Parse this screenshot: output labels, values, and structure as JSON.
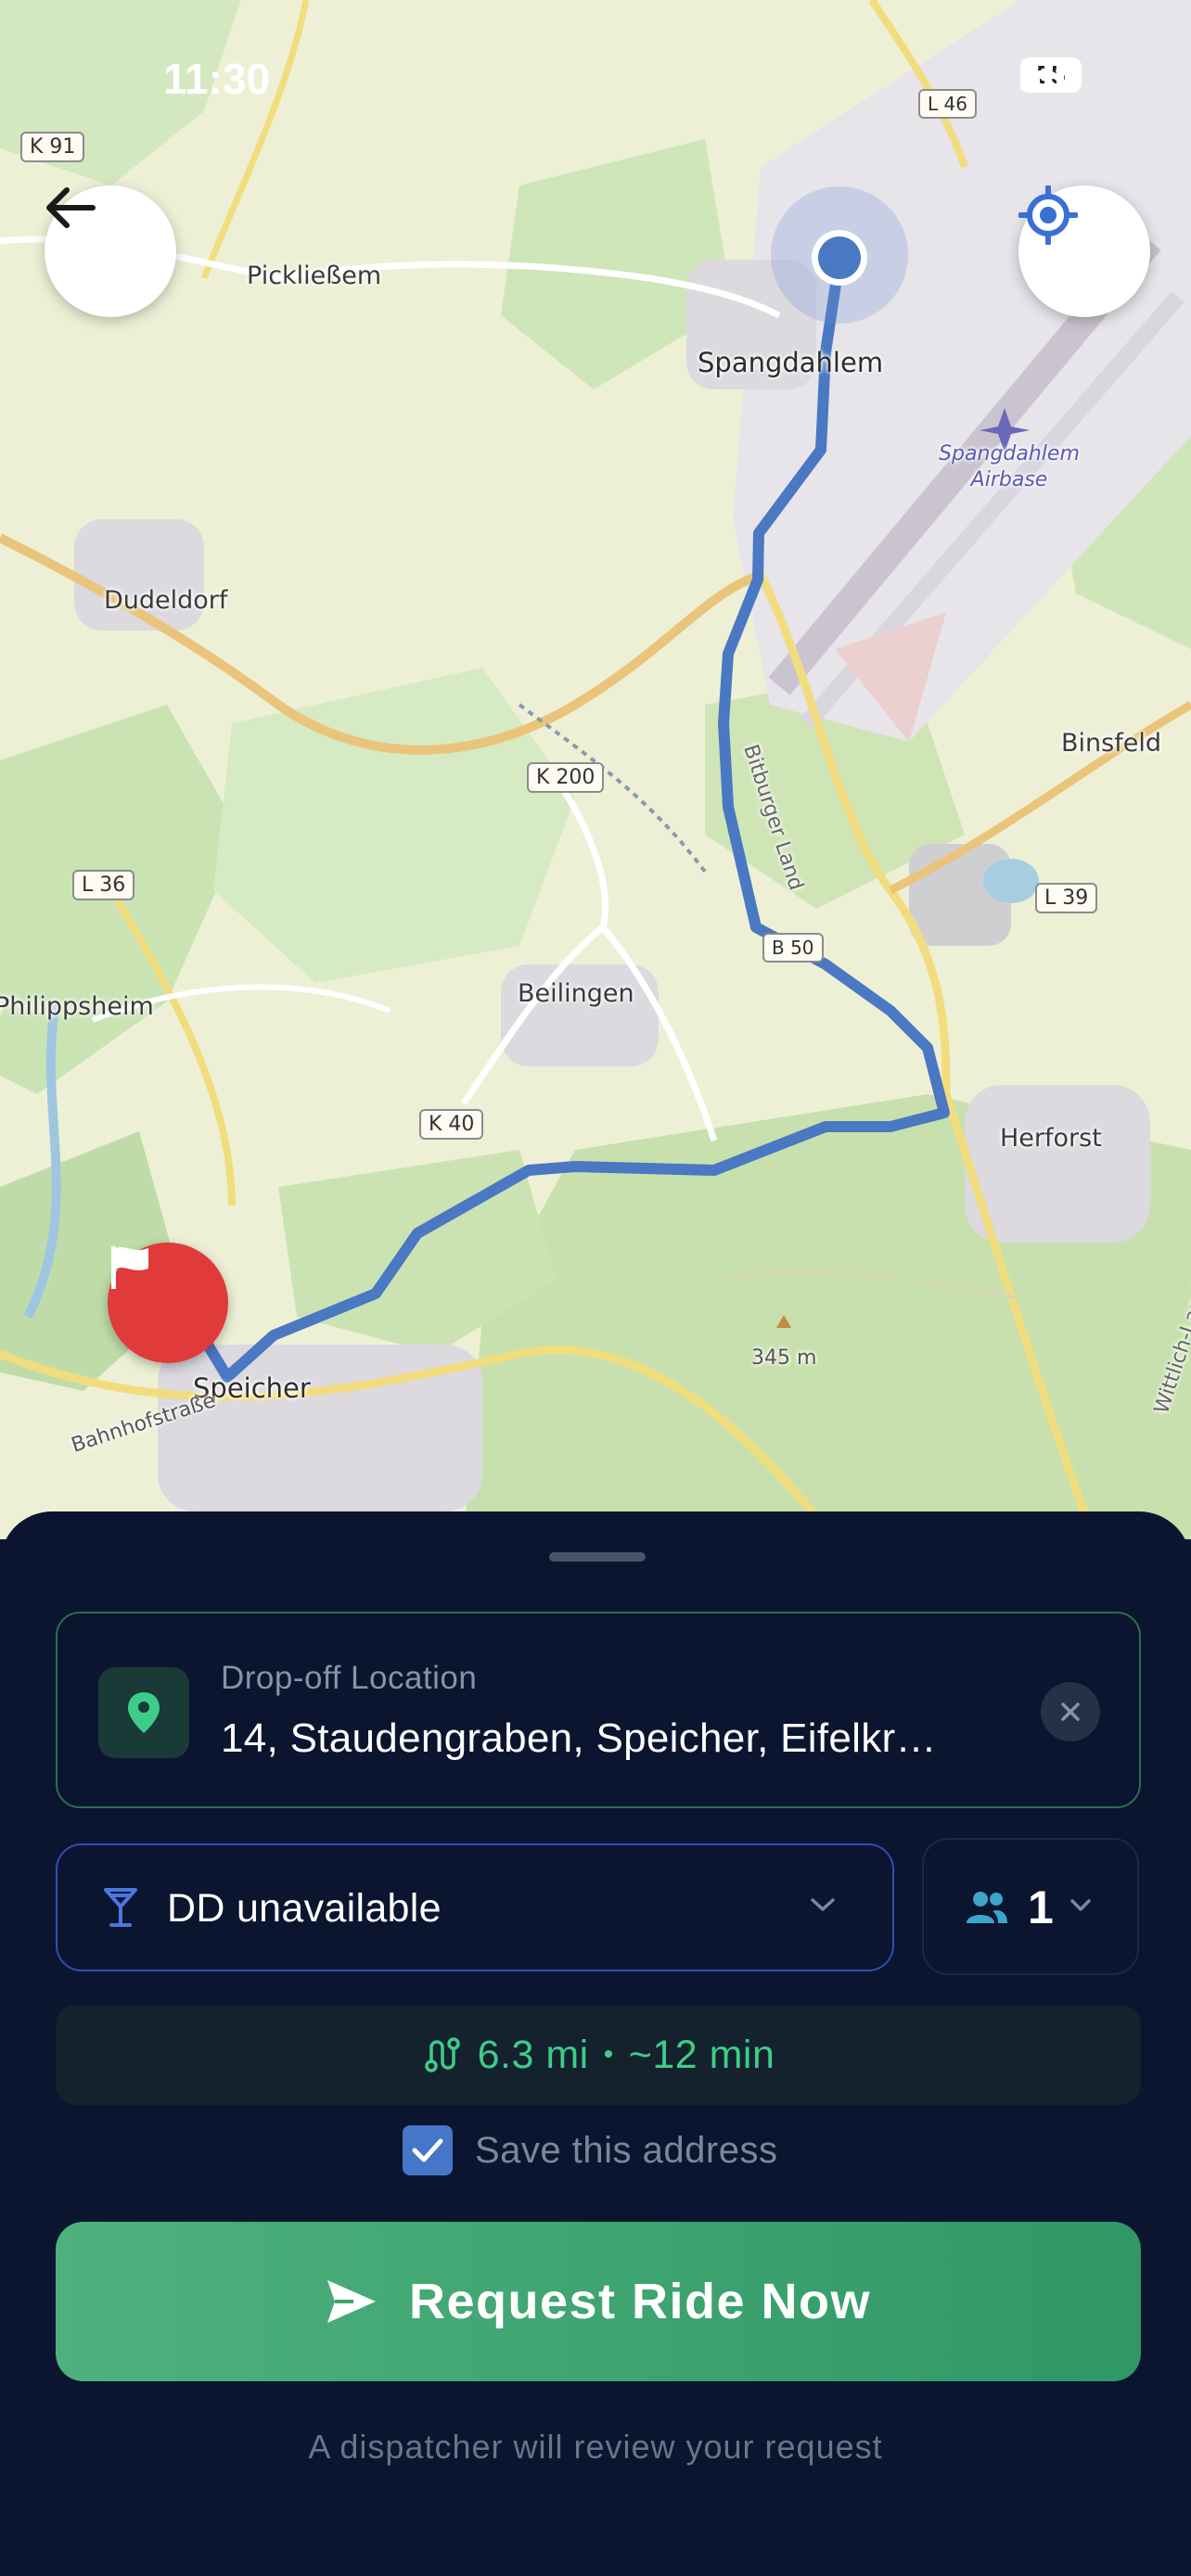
{
  "status_bar": {
    "time": "11:30",
    "battery": "55"
  },
  "map": {
    "places": [
      "K 91",
      "Pickließem",
      "Spangdahlem",
      "Spangdahlem Airbase",
      "Dudeldorf",
      "K 200",
      "Binsfeld",
      "L 36",
      "L 39",
      "Philippsheim",
      "Beilingen",
      "K 40",
      "Herforst",
      "Speicher",
      "Bahnhofstraße",
      "345 m",
      "L 46",
      "B 50",
      "Bitburger Land",
      "Wittlich-Land",
      "Speicher"
    ],
    "route_color": "#4a78c2",
    "flag_color": "#e03a3a"
  },
  "sheet": {
    "dropoff": {
      "label": "Drop-off Location",
      "value": "14, Staudengraben, Speicher, Eifelkr…"
    },
    "dd": {
      "label": "DD unavailable"
    },
    "passengers": {
      "count": "1"
    },
    "route": {
      "distance": "6.3 mi",
      "separator": "•",
      "duration": "~12 min"
    },
    "save": {
      "label": "Save this address",
      "checked": true
    },
    "request_button": {
      "label": "Request Ride Now"
    },
    "note": "A dispatcher will review your request"
  },
  "colors": {
    "sheet_bg": "#0b1530",
    "accent_green": "#3fcc89",
    "button_green": "#4fb17d",
    "select_border": "#2f4db0"
  }
}
